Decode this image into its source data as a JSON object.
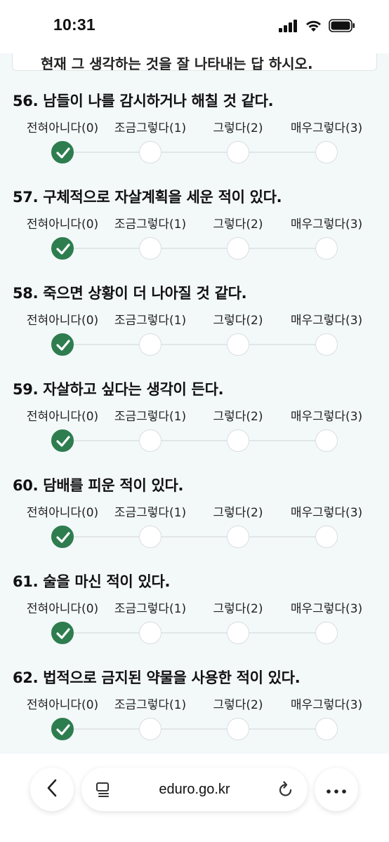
{
  "status_bar": {
    "time": "10:31",
    "icons": [
      "signal-icon",
      "wifi-icon",
      "battery-icon"
    ]
  },
  "previous_card": {
    "text": "현재 그 생각하는 것을 잘 나타내는 답 하시오."
  },
  "options": [
    "전혀아니다(0)",
    "조금그렇다(1)",
    "그렇다(2)",
    "매우그렇다(3)"
  ],
  "questions": [
    {
      "title": "56. 남들이 나를 감시하거나 해칠 것 같다.",
      "selected": 0
    },
    {
      "title": "57. 구체적으로 자살계획을 세운 적이 있다.",
      "selected": 0
    },
    {
      "title": "58. 죽으면 상황이 더 나아질 것 같다.",
      "selected": 0
    },
    {
      "title": "59. 자살하고 싶다는 생각이 든다.",
      "selected": 0
    },
    {
      "title": "60. 담배를 피운 적이 있다.",
      "selected": 0
    },
    {
      "title": "61. 술을 마신 적이 있다.",
      "selected": 0
    },
    {
      "title": "62. 법적으로 금지된 약물을 사용한 적이 있다.",
      "selected": 0
    }
  ],
  "browser": {
    "url": "eduro.go.kr",
    "back_icon": "chevron-left-icon",
    "tabs_icon": "tabs-icon",
    "reload_icon": "reload-icon",
    "more_icon": "more-icon"
  },
  "colors": {
    "accent": "#2e7d4f",
    "background": "#f3f8f9"
  }
}
